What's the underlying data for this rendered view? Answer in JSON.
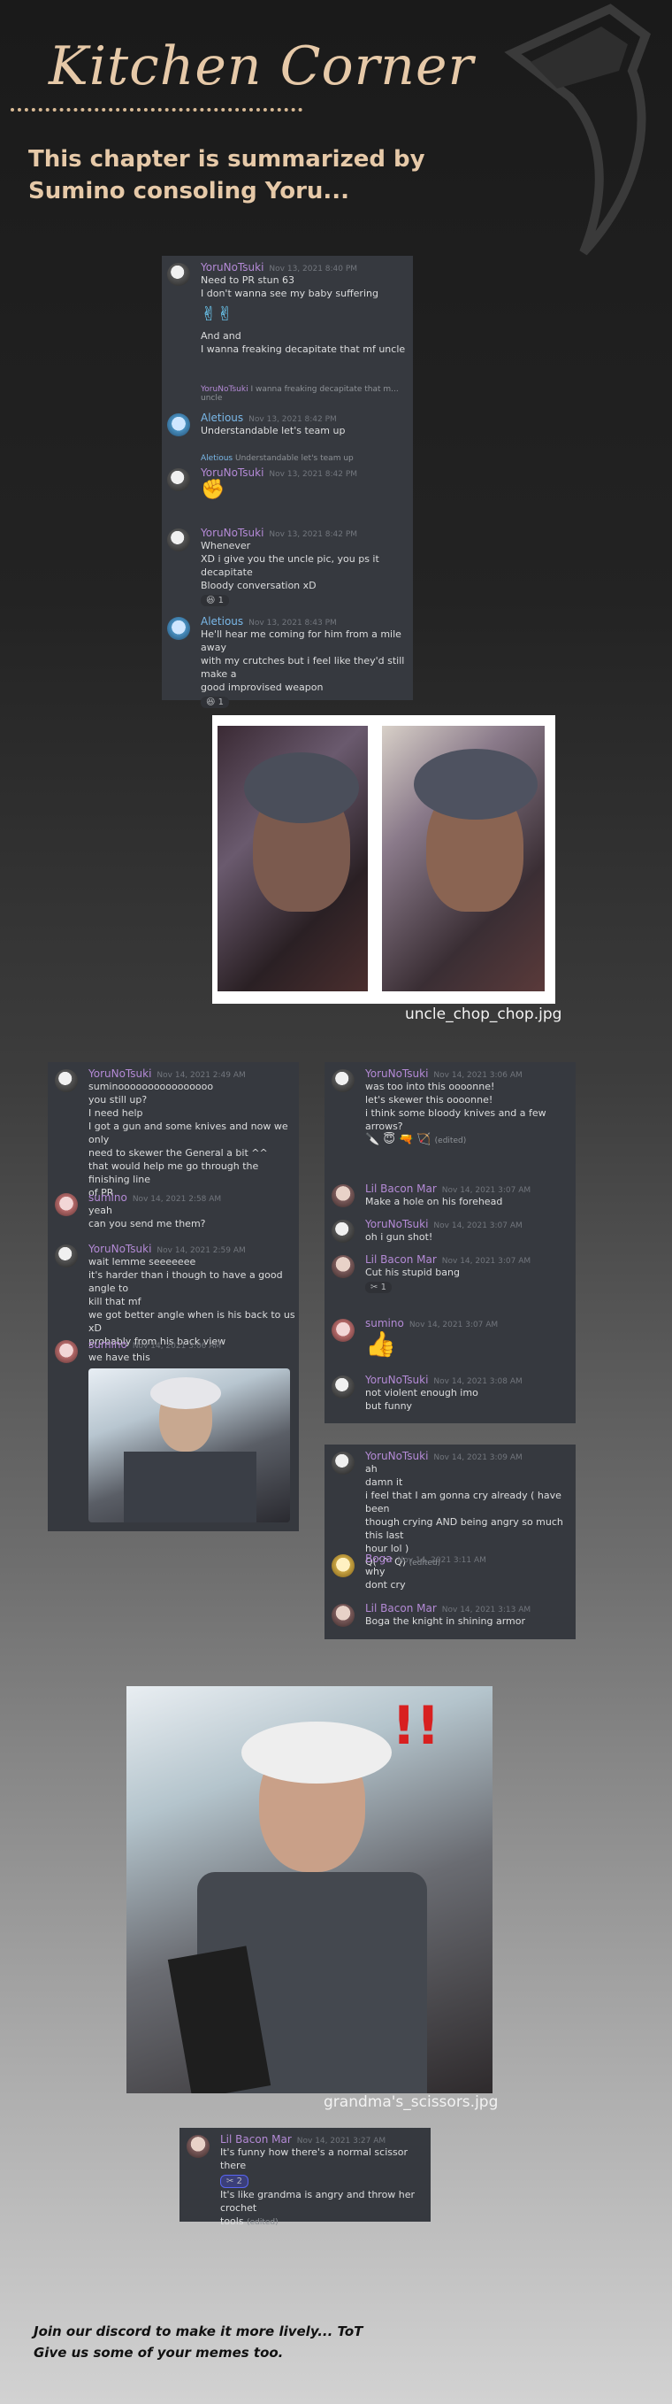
{
  "header": {
    "title": "Kitchen Corner",
    "subtitle_line1": "This chapter is summarized by",
    "subtitle_line2": "Sumino consoling Yoru..."
  },
  "chat1": {
    "m1": {
      "user": "YoruNoTsuki",
      "time": "Nov 13, 2021 8:40 PM",
      "l1": "Need to PR stun 63",
      "l2": "I don't wanna see my baby suffering",
      "l3": "And and",
      "l4": "I wanna freaking decapitate that mf uncle"
    },
    "reply1": {
      "user": "YoruNoTsuki",
      "text": "I wanna freaking decapitate that m...",
      "extra": "uncle"
    },
    "m2": {
      "user": "Aletious",
      "time": "Nov 13, 2021 8:42 PM",
      "l1": "Understandable let's team up"
    },
    "reply2": {
      "user": "Aletious",
      "text": "Understandable let's team up"
    },
    "m3": {
      "user": "YoruNoTsuki",
      "time": "Nov 13, 2021 8:42 PM"
    },
    "m4": {
      "user": "YoruNoTsuki",
      "time": "Nov 13, 2021 8:42 PM",
      "l1": "Whenever",
      "l2": "XD i give you the uncle pic, you ps it decapitate",
      "l3": "Bloody conversation xD",
      "react": "1"
    },
    "m5": {
      "user": "Aletious",
      "time": "Nov 13, 2021 8:43 PM",
      "l1": "He'll hear me coming for him from a mile away",
      "l2": "with my crutches but i feel like they'd still make a",
      "l3": "good improvised weapon",
      "react": "1"
    }
  },
  "image1": {
    "caption": "uncle_chop_chop.jpg"
  },
  "chat2": {
    "m1": {
      "user": "YoruNoTsuki",
      "time": "Nov 14, 2021 2:49 AM",
      "l1": "suminoooooooooooooooo",
      "l2": "you still up?",
      "l3": "I need help",
      "l4": "I got a gun and some knives and now we only",
      "l5": "need to skewer the General a bit ^^",
      "l6": "that would help me go through the finishing line",
      "l7": "of PR"
    },
    "m2": {
      "user": "sumino",
      "time": "Nov 14, 2021 2:58 AM",
      "l1": "yeah",
      "l2": "can you send me them?"
    },
    "m3": {
      "user": "YoruNoTsuki",
      "time": "Nov 14, 2021 2:59 AM",
      "l1": "wait lemme seeeeeee",
      "l2": "it's harder than i though to have a good angle to",
      "l3": "kill that mf",
      "l4": "we got better angle when is his back to us xD",
      "l5": "probably from his back view"
    },
    "m4": {
      "user": "sumino",
      "time": "Nov 14, 2021 3:06 AM",
      "l1": "we have this"
    }
  },
  "chat3": {
    "m1": {
      "user": "YoruNoTsuki",
      "time": "Nov 14, 2021 3:06 AM",
      "l1": "was too into this oooonne!",
      "l2": "let's skewer this oooonne!",
      "l3": "i think some bloody knives and a few arrows?",
      "edited": "(edited)"
    },
    "m2": {
      "user": "Lil Bacon Mar",
      "time": "Nov 14, 2021 3:07 AM",
      "l1": "Make a hole on his forehead"
    },
    "m3": {
      "user": "YoruNoTsuki",
      "time": "Nov 14, 2021 3:07 AM",
      "l1": "oh i gun shot!"
    },
    "m4": {
      "user": "Lil Bacon Mar",
      "time": "Nov 14, 2021 3:07 AM",
      "l1": "Cut his stupid bang",
      "react": "1"
    },
    "m5": {
      "user": "sumino",
      "time": "Nov 14, 2021 3:07 AM"
    },
    "m6": {
      "user": "YoruNoTsuki",
      "time": "Nov 14, 2021 3:08 AM",
      "l1": "not violent enough imo",
      "l2": "but funny"
    }
  },
  "chat4": {
    "m1": {
      "user": "YoruNoTsuki",
      "time": "Nov 14, 2021 3:09 AM",
      "l1": "ah",
      "l2": "damn it",
      "l3": "i feel that I am gonna cry already ( have been",
      "l4": "though crying AND being angry so much this last",
      "l5": "hour lol )",
      "l6": "Q(´^`Q)",
      "edited": "(edited)"
    },
    "m2": {
      "user": "Boga",
      "time": "Nov 14, 2021 3:11 AM",
      "l1": "why",
      "l2": "dont cry"
    },
    "m3": {
      "user": "Lil Bacon Mar",
      "time": "Nov 14, 2021 3:13 AM",
      "l1": "Boga the knight in shining armor"
    }
  },
  "image2": {
    "caption": "grandma's_scissors.jpg"
  },
  "chat5": {
    "m1": {
      "user": "Lil Bacon Mar",
      "time": "Nov 14, 2021 3:27 AM",
      "l1": "It's funny how there's a normal scissor there",
      "react": "2",
      "l2": "It's like grandma is angry and throw her crochet",
      "l3": "tools",
      "edited": "(edited)"
    }
  },
  "footer": {
    "line1": "Join our discord to make it more lively... ToT",
    "line2": "Give us some of your memes too."
  },
  "colors": {
    "title": "#e6c9a8",
    "discord_bg": "#36393f",
    "username": "#b48ad6"
  }
}
